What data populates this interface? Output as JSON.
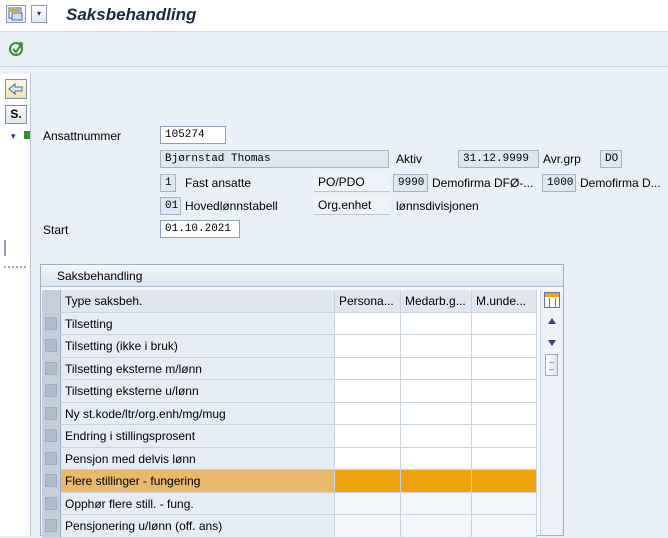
{
  "app": {
    "title": "Saksbehandling",
    "menu_arrow": "▾"
  },
  "left_pane": {
    "s_button_label": "S.",
    "tree_arrow": "▾"
  },
  "form": {
    "ansattnummer_label": "Ansattnummer",
    "ansattnummer_value": "105274",
    "name_value": "Bjørnstad Thomas",
    "aktiv_label": "Aktiv",
    "aktiv_value": "31.12.9999",
    "avrgrp_label": "Avr.grp",
    "avrgrp_value": "DO",
    "group_code": "1",
    "group_text": "Fast ansatte",
    "popdo_label": "PO/PDO",
    "popdo_code": "9990",
    "popdo_text": "Demofirma DFØ-...",
    "firm_code": "1000",
    "firm_text": "Demofirma D...",
    "lonn_code": "01",
    "lonn_text": "Hovedlønnstabell",
    "orgenhet_label": "Org.enhet",
    "orgenhet_text": "lønnsdivisjonen",
    "start_label": "Start",
    "start_value": "01.10.2021"
  },
  "table": {
    "panel_title": "Saksbehandling",
    "columns": [
      "Type saksbeh.",
      "Persona...",
      "Medarb.g...",
      "M.unde..."
    ],
    "rows": [
      "Tilsetting",
      "Tilsetting (ikke i bruk)",
      "Tilsetting eksterne m/lønn",
      "Tilsetting eksterne u/lønn",
      "Ny st.kode/ltr/org.enh/mg/mug",
      "Endring i stillingsprosent",
      "Pensjon med delvis lønn",
      "Flere stillinger - fungering",
      "Opphør flere still. - fung.",
      "Pensjonering u/lønn (off. ans)"
    ],
    "highlight_color": "#f0a30a"
  }
}
